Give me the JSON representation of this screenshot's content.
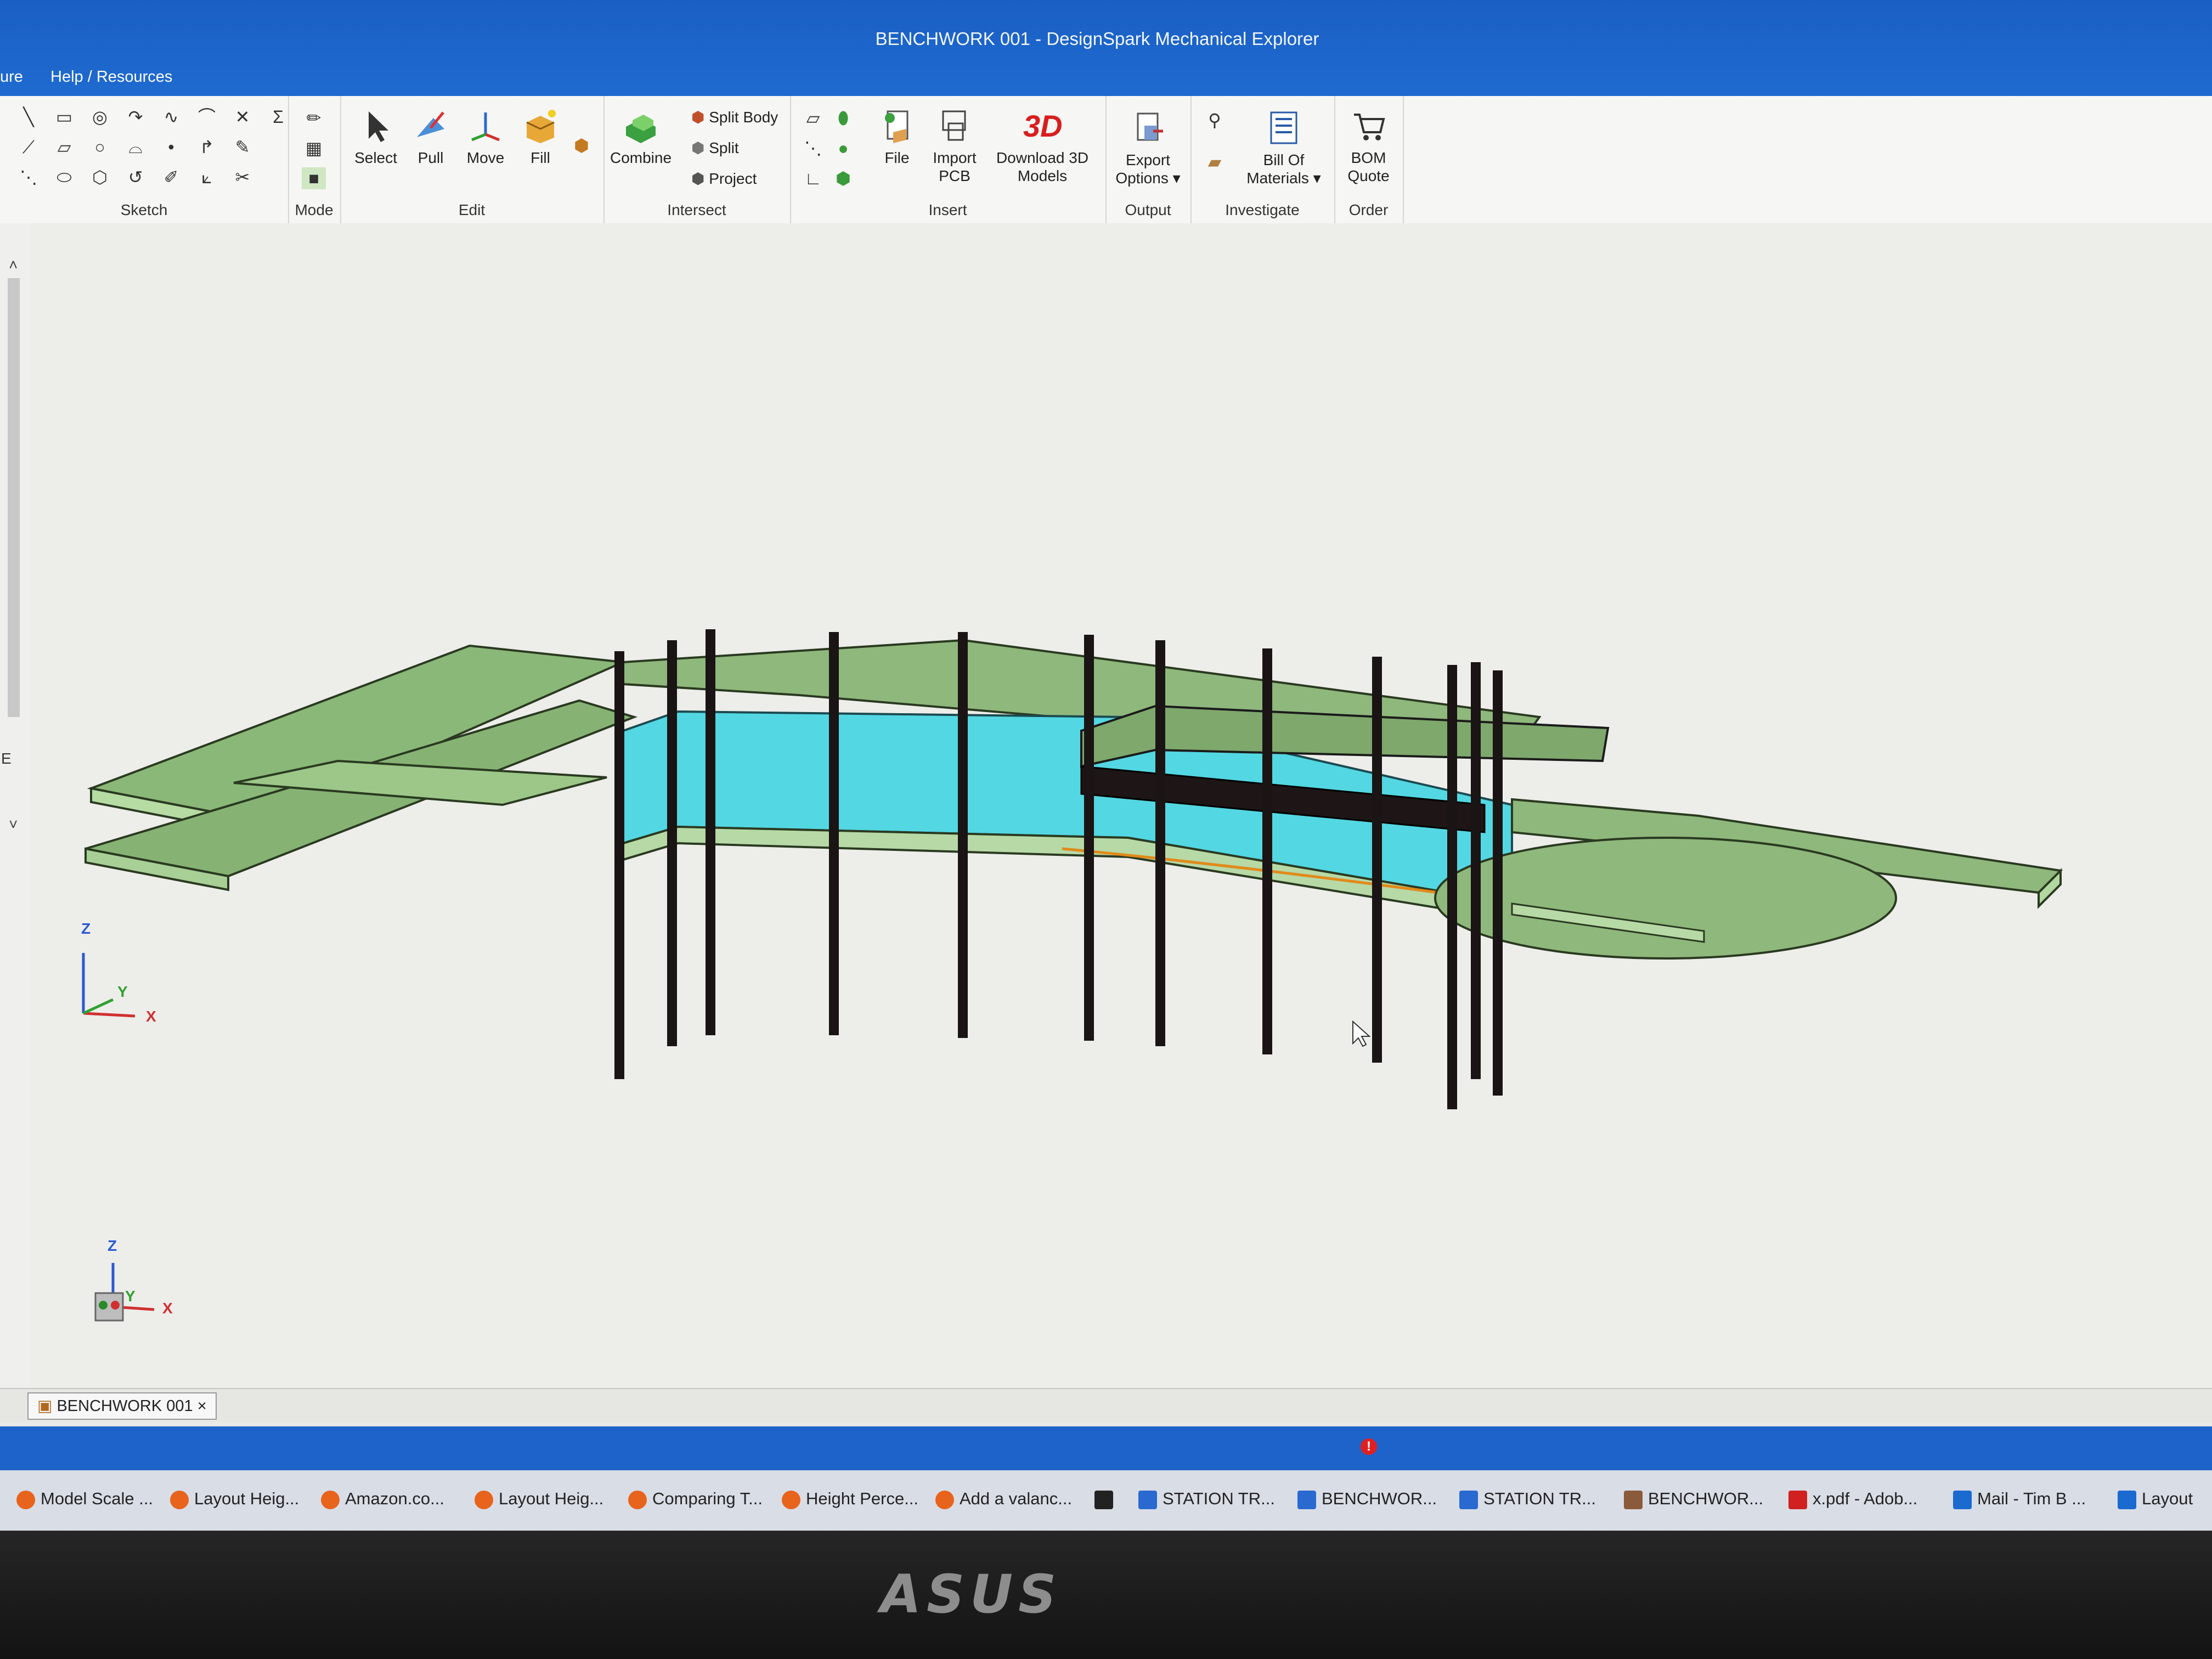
{
  "window": {
    "title": "BENCHWORK 001 - DesignSpark Mechanical Explorer"
  },
  "menu": {
    "items": [
      "ure",
      "Help / Resources"
    ]
  },
  "ribbon": {
    "groups": {
      "sketch": "Sketch",
      "mode": "Mode",
      "edit": "Edit",
      "intersect": "Intersect",
      "insert": "Insert",
      "output": "Output",
      "investigate": "Investigate",
      "order": "Order"
    },
    "tools": {
      "select": "Select",
      "pull": "Pull",
      "move": "Move",
      "fill": "Fill",
      "combine": "Combine",
      "split_body": "Split Body",
      "split": "Split",
      "project": "Project",
      "file": "File",
      "import_pcb_1": "Import",
      "import_pcb_2": "PCB",
      "download_1": "Download 3D",
      "download_2": "Models",
      "download_icon_text": "3D",
      "export_1": "Export",
      "export_2": "Options ▾",
      "bom_1": "Bill Of",
      "bom_2": "Materials ▾",
      "quote_1": "BOM",
      "quote_2": "Quote"
    }
  },
  "viewport": {
    "axes_main": {
      "z": "Z",
      "y": "Y",
      "x": "X"
    },
    "axes_cube": {
      "z": "Z",
      "y": "Y",
      "x": "X"
    },
    "left_letter": "E"
  },
  "doc_tab": {
    "label": "BENCHWORK 001",
    "close": "×"
  },
  "taskbar": {
    "items": [
      "Model Scale ...",
      "Layout Heig...",
      "Amazon.co...",
      "Layout Heig...",
      "Comparing T...",
      "Height Perce...",
      "Add a valanc...",
      "STATION TR...",
      "BENCHWOR...",
      "STATION TR...",
      "BENCHWOR...",
      "x.pdf - Adob...",
      "Mail - Tim B ...",
      "Layout"
    ]
  },
  "monitor": {
    "brand": "ASUS"
  },
  "colors": {
    "titlebar": "#1f6bd0",
    "deck": "#8fb57a",
    "fascia": "#4fd7e0",
    "legs": "#1a1414",
    "accent": "#e08a1a"
  }
}
